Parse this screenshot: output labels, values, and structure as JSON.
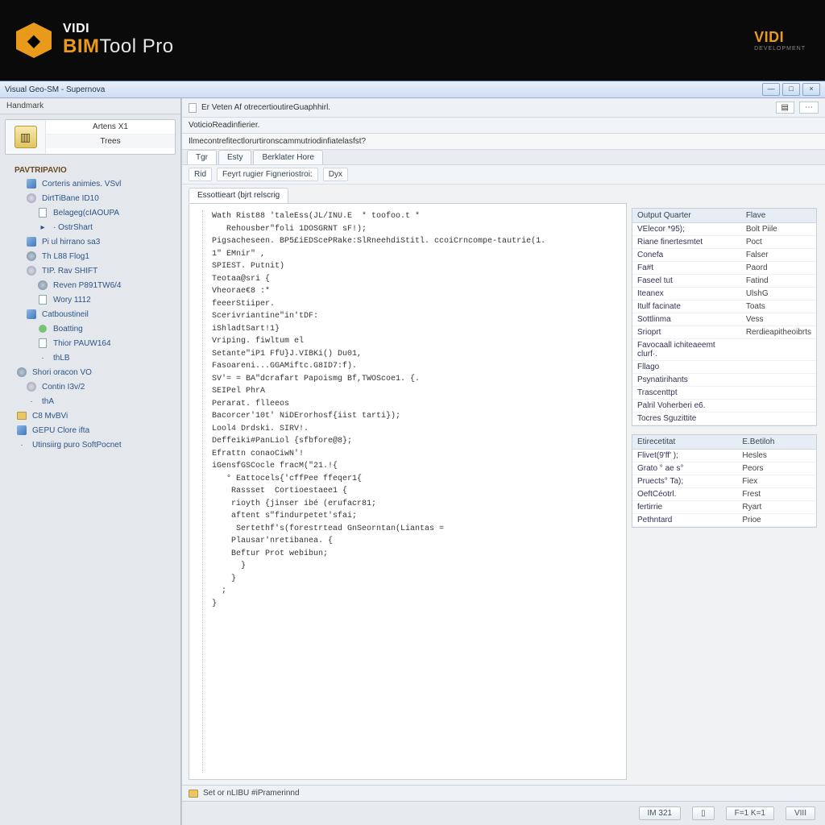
{
  "brand": {
    "top_line": "VIDI",
    "bim": "BIM",
    "tool": "Tool Pro",
    "right": "VIDI",
    "right_sub": "DEVELOPMENT"
  },
  "window": {
    "title": "Visual Geo-SM - Supernova",
    "min": "—",
    "max": "□",
    "close": "×"
  },
  "nav": {
    "header": "Handmark",
    "card": {
      "title": "Artens X1",
      "sub": "Trees"
    },
    "group1": "PAVTRIPAVIO",
    "items": [
      "Corteris animies. VSvl",
      "DirtTiBane ID10",
      "Belageg(cIAOUPA",
      "· OstrShart",
      "Pi ul hirrano sa3",
      "Th L88 Flog1",
      "TIP. Rav SHIFT",
      "Reven P891TW6/4",
      "Wory 1112",
      "Catboustineil",
      "Boatting",
      "Thior PAUW164",
      "thLB",
      "Shori oracon VO",
      "Contin I3v/2",
      "thA",
      "C8  MvBVi",
      "GEPU Clore ifta",
      "Utinsiirg puro SoftPocnet"
    ]
  },
  "editor": {
    "header_line1": "Er Veten Af otrecertioutireGuaphhirl.",
    "header_line2": "VoticioReadinfierier.",
    "header_line3": "Ilmecontrefitectlorurtironscammutriodinfiatelasfst?",
    "tabs": [
      "Tgr",
      "Esty",
      "Berklater Hore"
    ],
    "subtabs": [
      "Rid",
      "Feyrt rugier Figneriostroi:",
      "Dyx"
    ],
    "open_file": "Essottieart (bjrt relscrig",
    "code_lines": [
      "Wath Rist88 'taleEss(JL/INU.E  * toofoo.t *",
      "   Rehousber\"foli 1DOSGRNT sF!);",
      "Pigsacheseen. BP5£iEDScePRake:SlRneehdiStitl. ccoiCrncompe-tautrie(1.",
      "1\" EMnir\" ,",
      "SPIEST. Putnit)",
      "Teotaa@sri {",
      "Vheorae€8 :*",
      "feeerStiiper.",
      "Scerivriantine\"in'tDF:",
      "iShladtSart!1}",
      "Vriping. fiwltum el",
      "Setante\"iP1 FfU}J.VIBKi() Du01,",
      "Fasoareni...GGAMiftc.G8ID7:f).",
      "SV'= = BA\"dcrafart Papoismg Bf,TWOScoe1. {.",
      "SEIPel PhrA",
      "Perarat. flleeos",
      "Bacorcer'10t' NiDErorhosf{iist tarti});",
      "Lool4 Drdski. SIRV!.",
      "Deffeiki#PanLiol {sfbfore@8};",
      "Efrattn conaoCiwN'!",
      "iGensfGSCocle fracM(\"21.!{",
      "   ° Eattocels{'cffPee ffeqer1{",
      "    Rassset  Cortioestaee1 {",
      "    rioyth {jinser ibé (erufacr81;",
      "    aftent s\"findurpetet'sfai;",
      "     Sertethf's(forestrtead GnSeorntan(Liantas =",
      "    Plausar'nretibanea. {",
      "    Beftur Prot webibun;",
      "      }",
      "    }",
      "  ;",
      "}"
    ],
    "props1": {
      "col1": "Output Quarter",
      "col2": "Flave",
      "rows": [
        [
          "VElecor *95);",
          "Bolt Piile"
        ],
        [
          "Riane finertesmtet",
          "Poct"
        ],
        [
          "Conefa",
          "Falser"
        ],
        [
          "Fa#t",
          "Paord"
        ],
        [
          "Faseel tut",
          "Fatind"
        ],
        [
          "Iteanex",
          "UlshG"
        ],
        [
          "Itulf facinate",
          "Toats"
        ],
        [
          "Sottlinma",
          "Vess"
        ],
        [
          "Srioprt",
          "Rerdieapitheoibrts"
        ],
        [
          "Favocaall ichiteaeemt clurf·.",
          ""
        ],
        [
          "Fllago",
          ""
        ],
        [
          "Psynatirihants",
          ""
        ],
        [
          "Trascenttpt",
          ""
        ],
        [
          "Palril Voherberi e6.",
          ""
        ],
        [
          "Tocres Sguzittite",
          ""
        ]
      ]
    },
    "props2": {
      "col1": "Etirecetitat",
      "col2": "E.Betiloh",
      "rows": [
        [
          "Flivet(9'ff' );",
          "Hesles"
        ],
        [
          "Grato ° ae s°",
          "Peors"
        ],
        [
          "Pruects° Ta);",
          "Fiex"
        ],
        [
          "OeftCéotrl.",
          "Frest"
        ],
        [
          "fertirrie",
          "Ryart"
        ],
        [
          "Pethntard",
          "Prioe"
        ]
      ]
    },
    "footer": "Set or nLIBU #iPramerinnd"
  },
  "status": {
    "b1": "IM 321",
    "b2": "▯",
    "b3": "F=1 K=1",
    "b4": "VIII"
  }
}
